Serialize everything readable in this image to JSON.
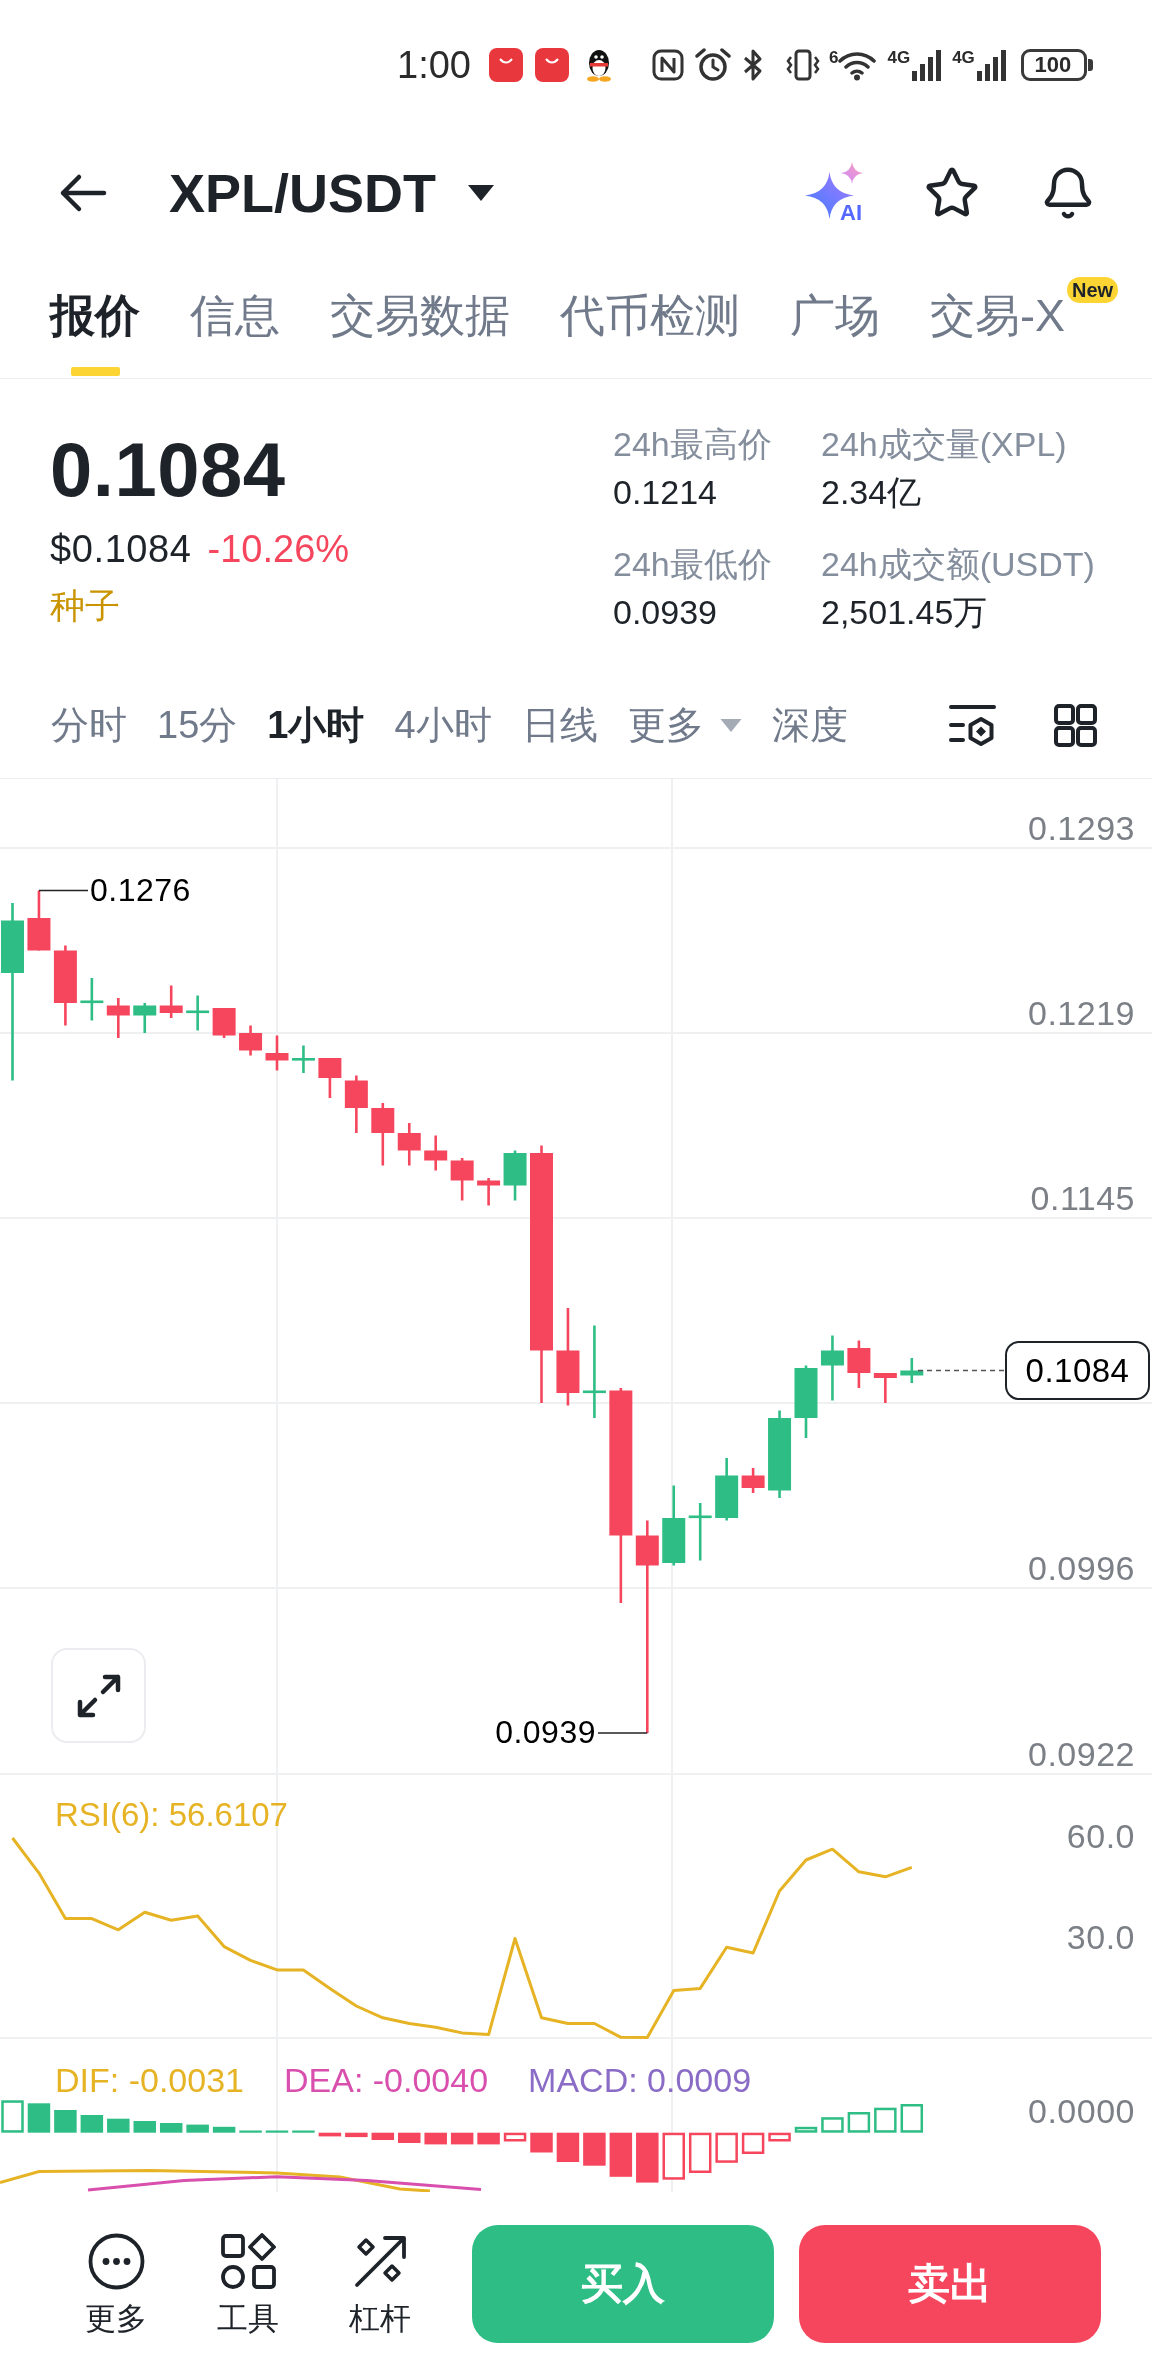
{
  "status_bar": {
    "time": "1:00",
    "wifi_label": "6",
    "network_labels": [
      "4G",
      "4G"
    ],
    "battery": "100"
  },
  "header": {
    "title": "XPL/USDT",
    "ai_label": "AI",
    "favorite": false
  },
  "tabs": [
    {
      "label": "报价",
      "selected": true
    },
    {
      "label": "信息",
      "selected": false
    },
    {
      "label": "交易数据",
      "selected": false
    },
    {
      "label": "代币检测",
      "selected": false
    },
    {
      "label": "广场",
      "selected": false
    },
    {
      "label": "交易-X",
      "selected": false,
      "badge": "New"
    }
  ],
  "quote": {
    "price": "0.1084",
    "usd_price": "$0.1084",
    "change": "-10.26%",
    "tag": "种子",
    "stats": [
      {
        "label": "24h最高价",
        "value": "0.1214"
      },
      {
        "label": "24h成交量(XPL)",
        "value": "2.34亿"
      },
      {
        "label": "24h最低价",
        "value": "0.0939"
      },
      {
        "label": "24h成交额(USDT)",
        "value": "2,501.45万"
      }
    ]
  },
  "intervals": [
    {
      "label": "分时",
      "kind": "option",
      "selected": false
    },
    {
      "label": "15分",
      "kind": "option",
      "selected": false
    },
    {
      "label": "1小时",
      "kind": "option",
      "selected": true
    },
    {
      "label": "4小时",
      "kind": "option",
      "selected": false
    },
    {
      "label": "日线",
      "kind": "option",
      "selected": false
    },
    {
      "label": "更多",
      "kind": "dropdown",
      "selected": false
    },
    {
      "label": "深度",
      "kind": "option",
      "selected": false
    }
  ],
  "price_chart": {
    "axis_labels": [
      "0.1293",
      "0.1219",
      "0.1145",
      "0.0996",
      "0.0922"
    ],
    "high_label": "0.1276",
    "low_label": "0.0939",
    "last_price": "0.1084"
  },
  "rsi": {
    "legend": "RSI(6): 56.6107",
    "chart_data": {
      "type": "line",
      "ylim": [
        0,
        78
      ],
      "yticks": [
        {
          "value": 60,
          "label": "60.0"
        },
        {
          "value": 30,
          "label": "30.0"
        }
      ],
      "series": [
        {
          "color": "#e6b325",
          "values": [
            59.6,
            49.2,
            35.7,
            35.7,
            32.4,
            37.6,
            35.2,
            36.5,
            27.4,
            23.3,
            20.5,
            20.5,
            15.0,
            9.8,
            6.3,
            4.6,
            3.5,
            1.8,
            1.3,
            29.8,
            6.3,
            4.6,
            4.6,
            0.5,
            0.0,
            14.4,
            15.0,
            27.2,
            25.5,
            43.9,
            53.1,
            56.3,
            49.6,
            48.1,
            50.9
          ]
        }
      ]
    }
  },
  "macd": {
    "legend": [
      {
        "text": "DIF: -0.0031",
        "color": "#e6b325"
      },
      {
        "text": "DEA: -0.0040",
        "color": "#d84fae"
      },
      {
        "text": "MACD: 0.0009",
        "color": "#8a6cc6"
      }
    ],
    "axis_label": "0.0000"
  },
  "bottom_bar": {
    "tools": [
      {
        "label": "更多"
      },
      {
        "label": "工具"
      },
      {
        "label": "杠杆"
      }
    ],
    "buy": "买入",
    "sell": "卖出"
  }
}
